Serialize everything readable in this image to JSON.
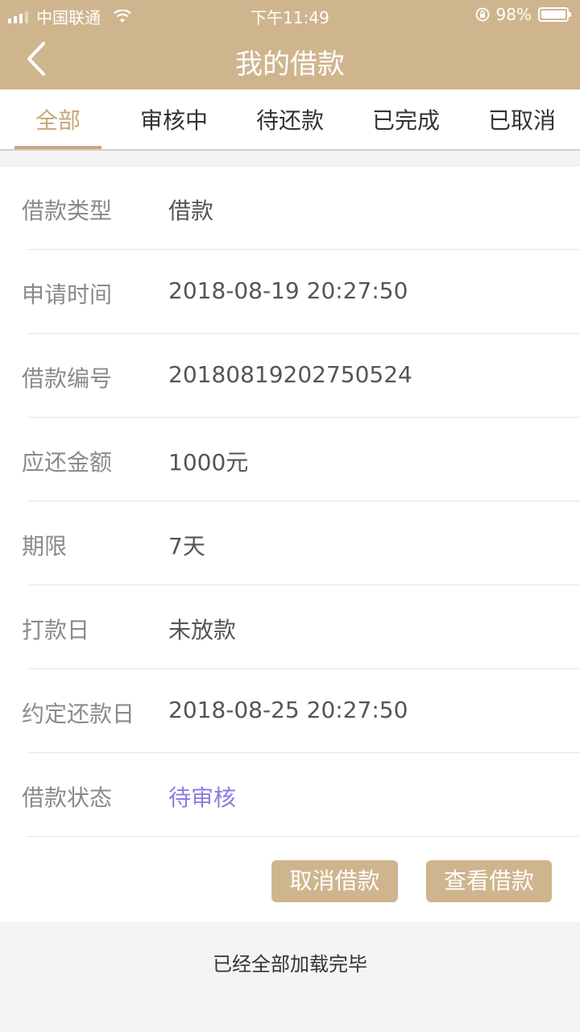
{
  "status_bar": {
    "carrier": "中国联通",
    "time": "下午11:49",
    "battery": "98%"
  },
  "header": {
    "title": "我的借款",
    "back_icon": "chevron-left-icon"
  },
  "tabs": [
    {
      "label": "全部",
      "active": true
    },
    {
      "label": "审核中",
      "active": false
    },
    {
      "label": "待还款",
      "active": false
    },
    {
      "label": "已完成",
      "active": false
    },
    {
      "label": "已取消",
      "active": false
    }
  ],
  "loan": {
    "fields": [
      {
        "label": "借款类型",
        "value": "借款"
      },
      {
        "label": "申请时间",
        "value": "2018-08-19 20:27:50"
      },
      {
        "label": "借款编号",
        "value": "20180819202750524"
      },
      {
        "label": "应还金额",
        "value": "1000元"
      },
      {
        "label": "期限",
        "value": "7天"
      },
      {
        "label": "打款日",
        "value": "未放款"
      },
      {
        "label": "约定还款日",
        "value": "2018-08-25 20:27:50"
      },
      {
        "label": "借款状态",
        "value": "待审核"
      }
    ],
    "cancel_label": "取消借款",
    "view_label": "查看借款"
  },
  "footer": {
    "loaded_text": "已经全部加载完毕"
  },
  "colors": {
    "accent": "#cfb58e",
    "active_tab": "#c9a876",
    "status_value": "#8a7de0"
  }
}
